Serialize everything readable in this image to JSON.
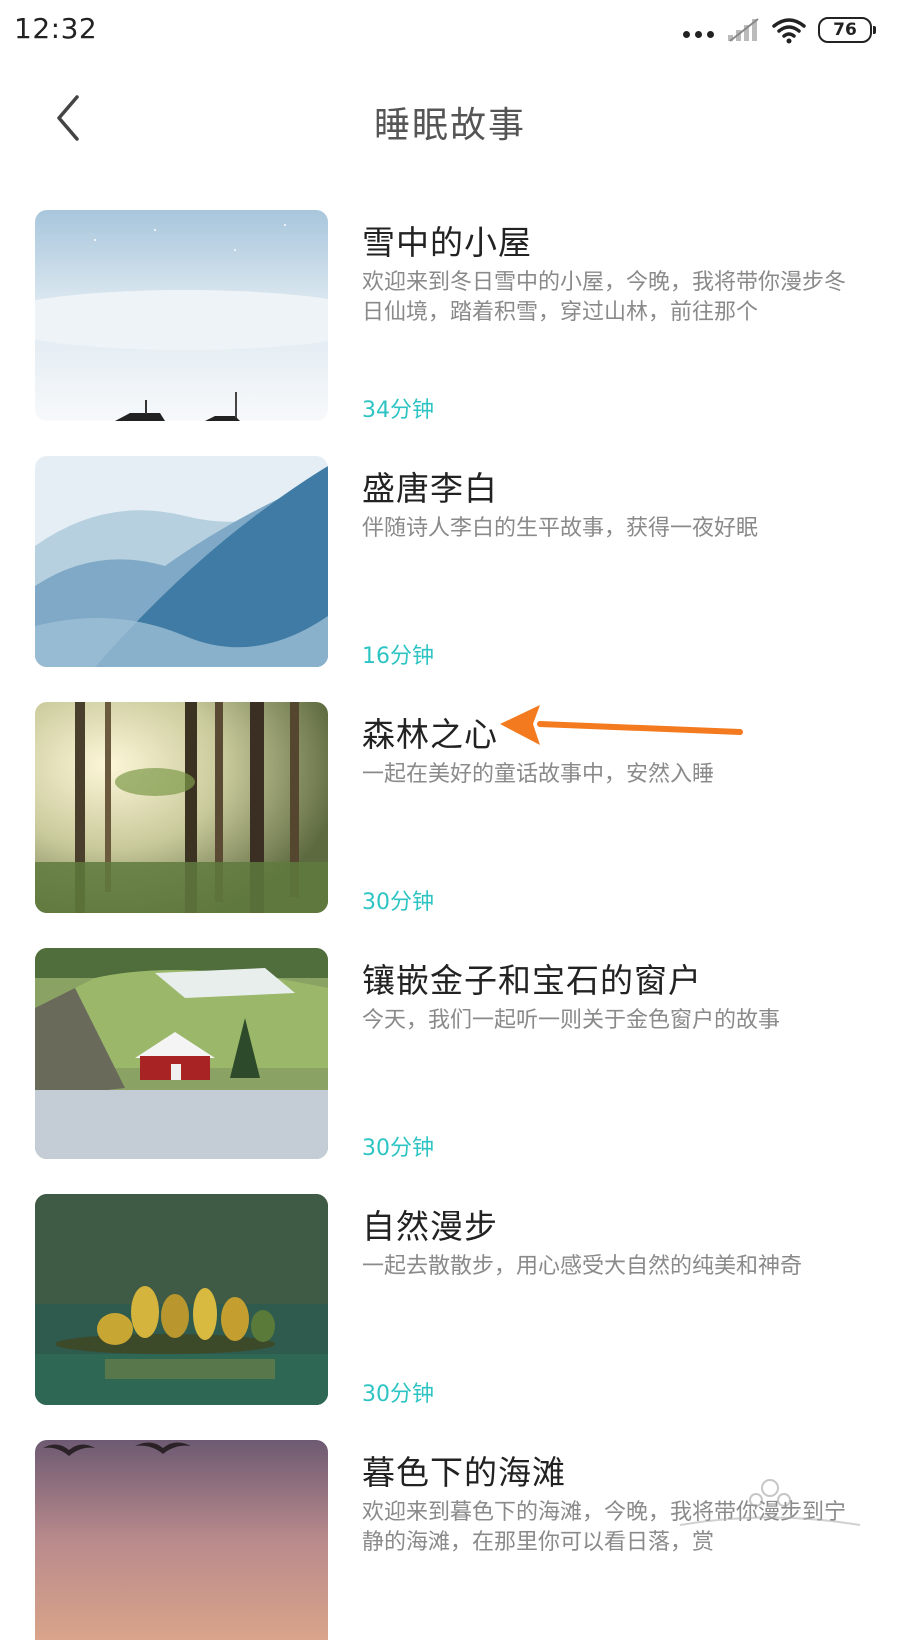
{
  "status_bar": {
    "time": "12:32",
    "battery": "76",
    "icons": [
      "more-dots-icon",
      "signal-icon",
      "wifi-icon",
      "battery-icon"
    ]
  },
  "header": {
    "title": "睡眠故事",
    "back_icon": "chevron-left-icon"
  },
  "stories": [
    {
      "title": "雪中的小屋",
      "description": "欢迎来到冬日雪中的小屋，今晚，我将带你漫步冬日仙境，踏着积雪，穿过山林，前往那个",
      "duration": "34分钟",
      "image": "snowy-cabin-image"
    },
    {
      "title": "盛唐李白",
      "description": "伴随诗人李白的生平故事，获得一夜好眠",
      "duration": "16分钟",
      "image": "misty-mountains-image"
    },
    {
      "title": "森林之心",
      "description": "一起在美好的童话故事中，安然入睡",
      "duration": "30分钟",
      "image": "sunlit-forest-image"
    },
    {
      "title": "镶嵌金子和宝石的窗户",
      "description": "今天，我们一起听一则关于金色窗户的故事",
      "duration": "30分钟",
      "image": "red-house-lake-image"
    },
    {
      "title": "自然漫步",
      "description": "一起去散散步，用心感受大自然的纯美和神奇",
      "duration": "30分钟",
      "image": "autumn-island-image"
    },
    {
      "title": "暮色下的海滩",
      "description": "欢迎来到暮色下的海滩，今晚，我将带你漫步到宁静的海滩，在那里你可以看日落，赏",
      "duration": "",
      "image": "dusk-beach-image"
    }
  ],
  "colors": {
    "accent": "#2ec4c4",
    "arrow": "#f47a20",
    "title_text": "#222222",
    "desc_text": "#8a8a8a"
  }
}
